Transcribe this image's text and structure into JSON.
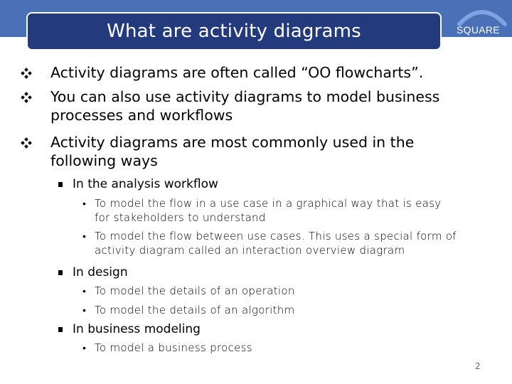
{
  "slide": {
    "title": "What are activity diagrams",
    "logo_text": "SQUARE",
    "page_number": "2",
    "colors": {
      "top_band": "#4a71b8",
      "title_box": "#233a7c",
      "title_text": "#ffffff"
    }
  },
  "bullets": [
    {
      "marker_icon": "diamond-bullet-icon",
      "lines": [
        "Activity diagrams are often called “OO flowcharts”."
      ]
    },
    {
      "marker_icon": "diamond-bullet-icon",
      "lines": [
        "You can also  use activity diagrams to model business",
        "processes and workflows"
      ]
    },
    {
      "marker_icon": "diamond-bullet-icon",
      "lines": [
        "Activity diagrams are most commonly used in the",
        "following ways"
      ]
    }
  ],
  "subbullets": [
    {
      "marker_icon": "square-bullet-icon",
      "label": "In the analysis workflow",
      "items": [
        {
          "lines": [
            "To model the flow in a use case in a graphical way that is easy",
            "for stakeholders to understand"
          ]
        },
        {
          "lines": [
            "To model the flow between use cases. This uses a special form of",
            "activity diagram called an interaction overview diagram"
          ]
        }
      ]
    },
    {
      "marker_icon": "square-bullet-icon",
      "label": "In design",
      "items": [
        {
          "lines": [
            "To model the details of an operation"
          ]
        },
        {
          "lines": [
            "To model the details of an algorithm"
          ]
        }
      ]
    },
    {
      "marker_icon": "square-bullet-icon",
      "label": "In business modeling",
      "items": [
        {
          "lines": [
            "To model a business process"
          ]
        }
      ]
    }
  ],
  "third_level_marker": "•"
}
